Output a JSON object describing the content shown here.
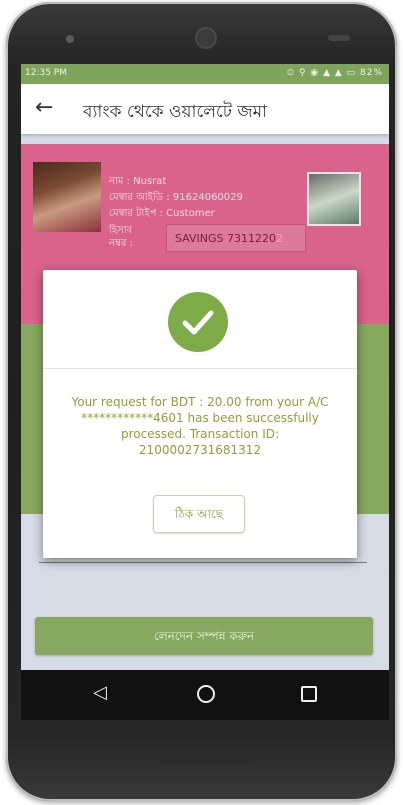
{
  "status_bar": {
    "time": "12:35 PM",
    "right_icons": "⏲ ⚲ ◉ ▲ ▲ ▭ 82%"
  },
  "app_bar": {
    "back_icon": "arrow-left-icon",
    "title": "ব্যাংক থেকে ওয়ালেটে জমা"
  },
  "member": {
    "name": "নাম : Nusrat",
    "member_id": "মেম্বার আইডি : 91624060029",
    "member_type": "মেম্বার টাইপ : Customer",
    "account_label": "হিসাব নম্বর :",
    "account_value": "SAVINGS 7311220",
    "account_value_suffix": "2"
  },
  "dialog": {
    "icon": "check-icon",
    "message": "Your request for BDT : 20.00 from your A/C ************4601 has been successfully processed. Transaction ID: 2100002731681312",
    "ok_label": "ঠিক আছে"
  },
  "submit_button": {
    "label": "লেনদেন সম্পন্ন করুন"
  },
  "colors": {
    "status_bar": "#7fa45c",
    "header_band": "#d9638a",
    "accent_green": "#86a95f",
    "check_green": "#7cab48",
    "message_text": "#8f9f38"
  },
  "nav_bar": {
    "back": "◁",
    "home": "home-circle-icon",
    "recent": "recent-square-icon"
  }
}
